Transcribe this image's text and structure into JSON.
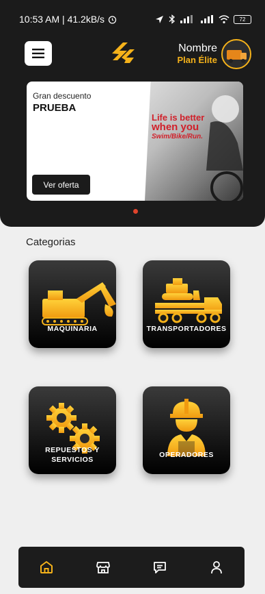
{
  "status_bar": {
    "time_speed": "10:53 AM | 41.2kB/s",
    "battery": "72"
  },
  "header": {
    "user_name": "Nombre",
    "plan": "Plan Élite"
  },
  "banner": {
    "subtitle": "Gran descuento",
    "title": "PRUEBA",
    "button_label": "Ver oferta",
    "image_text": [
      "Life is better",
      "when you",
      "Swim/Bike/Run."
    ]
  },
  "categories": {
    "heading": "Categorias",
    "items": [
      {
        "label": "MAQUINARIA",
        "icon": "excavator-icon"
      },
      {
        "label": "TRANSPORTADORES",
        "icon": "truck-bulldozer-icon"
      },
      {
        "label": "REPUESTOS Y SERVICIOS",
        "icon": "gears-icon"
      },
      {
        "label": "OPERADORES",
        "icon": "worker-icon"
      }
    ]
  },
  "bottom_nav": {
    "items": [
      "home-icon",
      "store-icon",
      "chat-icon",
      "profile-icon"
    ]
  },
  "colors": {
    "accent": "#f5b21a",
    "dark": "#1b1b1b",
    "background": "#efefef",
    "indicator": "#e0442c"
  }
}
